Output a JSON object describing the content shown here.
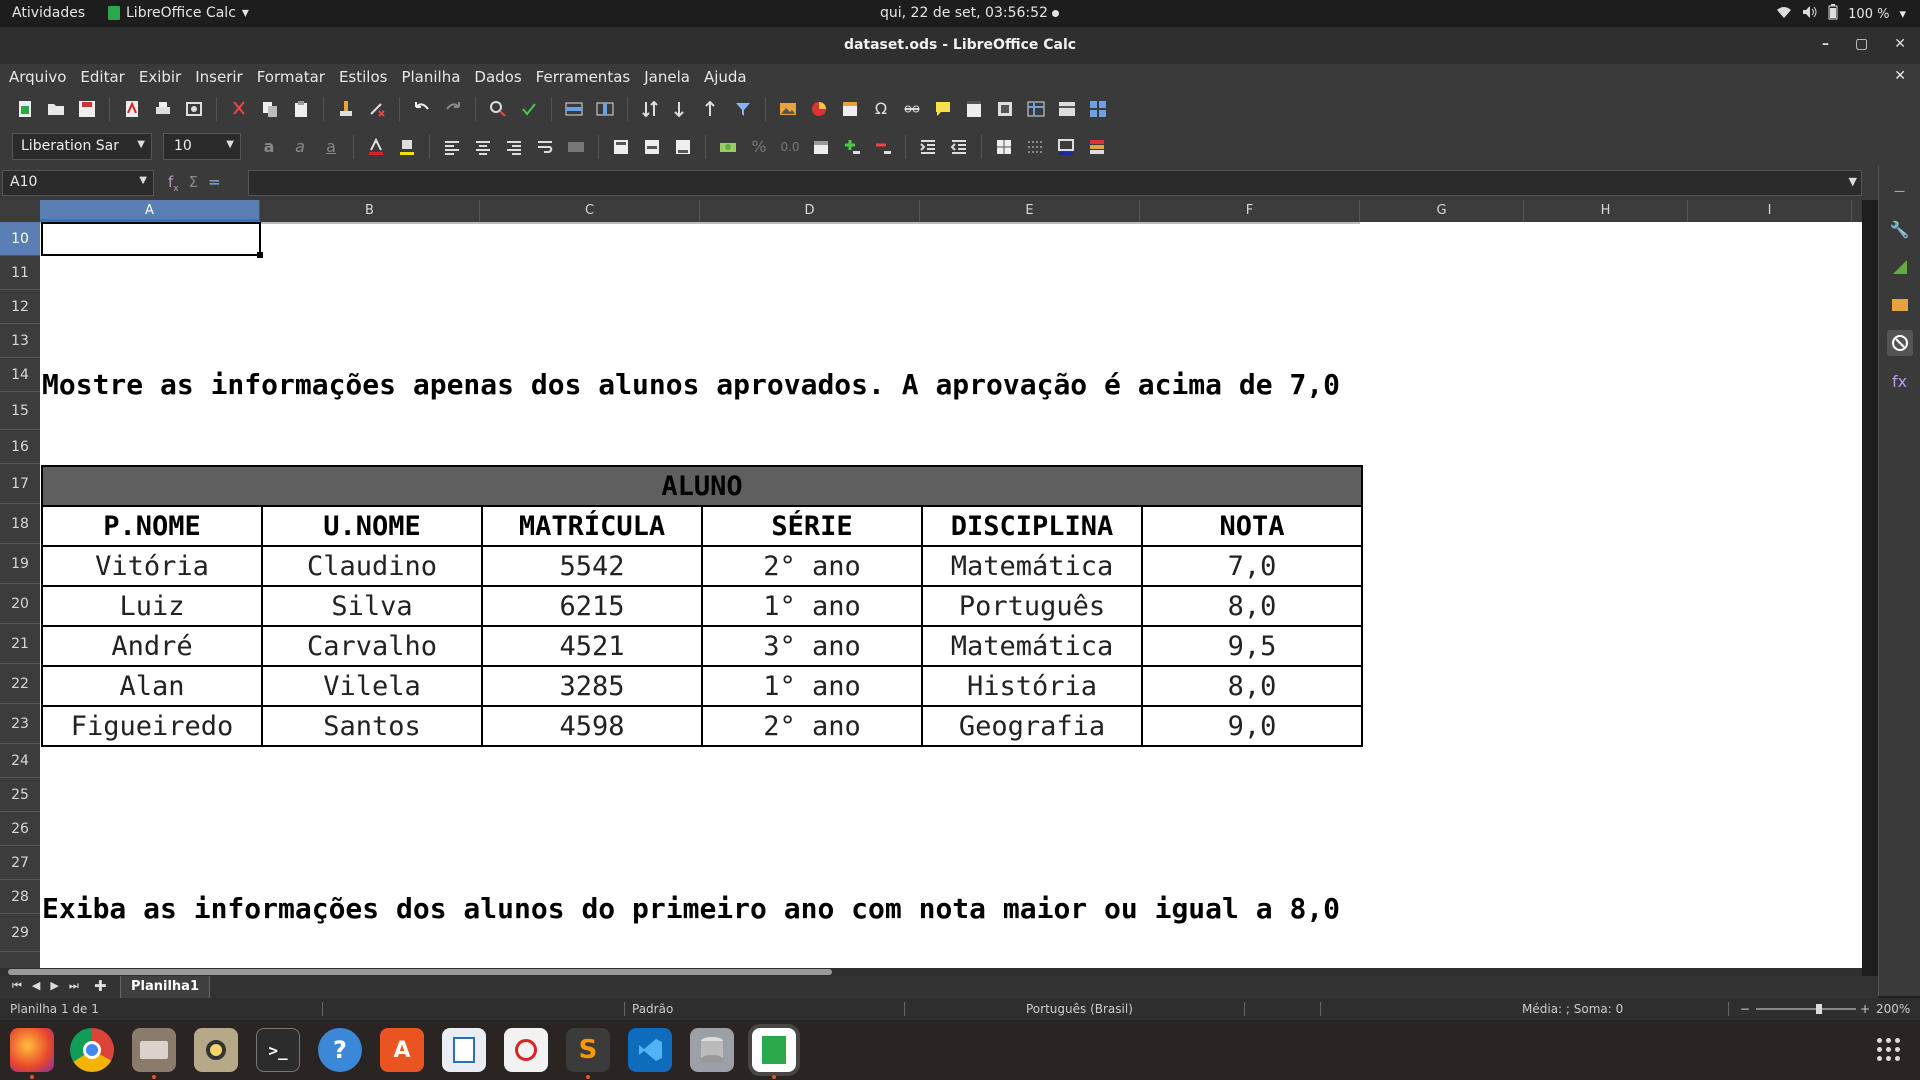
{
  "topbar": {
    "activities": "Atividades",
    "app_name": "LibreOffice Calc",
    "datetime": "qui, 22 de set, 03:56:52",
    "battery": "100 %"
  },
  "window": {
    "title": "dataset.ods - LibreOffice Calc"
  },
  "menubar": {
    "items": [
      "Arquivo",
      "Editar",
      "Exibir",
      "Inserir",
      "Formatar",
      "Estilos",
      "Planilha",
      "Dados",
      "Ferramentas",
      "Janela",
      "Ajuda"
    ]
  },
  "format_toolbar": {
    "font_name": "Liberation Sar",
    "font_size": "10"
  },
  "formula_bar": {
    "cell_ref": "A10",
    "content": ""
  },
  "columns": [
    "A",
    "B",
    "C",
    "D",
    "E",
    "F",
    "G",
    "H",
    "I"
  ],
  "rows": [
    "10",
    "11",
    "12",
    "13",
    "14",
    "15",
    "16",
    "17",
    "18",
    "19",
    "20",
    "21",
    "22",
    "23",
    "24",
    "25",
    "26",
    "27",
    "28",
    "29"
  ],
  "sheet": {
    "prompt1": "Mostre as informações apenas dos alunos aprovados. A aprovação é acima de 7,0",
    "prompt2": "Exiba as informações dos alunos do primeiro ano com nota maior ou igual a 8,0",
    "table_title": "ALUNO",
    "headers": [
      "P.NOME",
      "U.NOME",
      "MATRÍCULA",
      "SÉRIE",
      "DISCIPLINA",
      "NOTA"
    ],
    "rows": [
      [
        "Vitória",
        "Claudino",
        "5542",
        "2° ano",
        "Matemática",
        "7,0"
      ],
      [
        "Luiz",
        "Silva",
        "6215",
        "1° ano",
        "Português",
        "8,0"
      ],
      [
        "André",
        "Carvalho",
        "4521",
        "3° ano",
        "Matemática",
        "9,5"
      ],
      [
        "Alan",
        "Vilela",
        "3285",
        "1° ano",
        "História",
        "8,0"
      ],
      [
        "Figueiredo",
        "Santos",
        "4598",
        "2° ano",
        "Geografia",
        "9,0"
      ]
    ]
  },
  "sheet_tabs": {
    "active": "Planilha1"
  },
  "statusbar": {
    "sheet_info": "Planilha 1 de 1",
    "style": "Padrão",
    "language": "Português (Brasil)",
    "sum_info": "Média: ; Soma: 0",
    "zoom": "200%"
  },
  "theme": {
    "selected_header": "#5a7fb4",
    "table_title_bg": "#5f5f5f",
    "accent_running": "#e95420"
  }
}
